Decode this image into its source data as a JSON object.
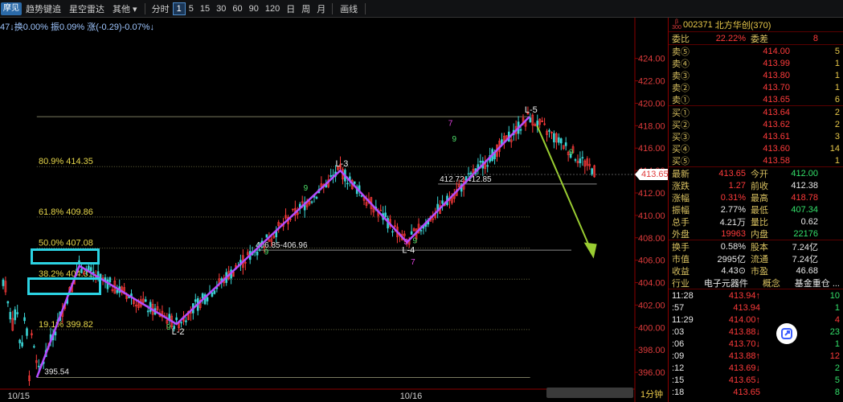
{
  "toolbar": {
    "chip": "摩见",
    "items": [
      "趋势键追",
      "星空雷达",
      "其他 ▾"
    ],
    "period_label": "分时",
    "periods": [
      "1",
      "5",
      "15",
      "30",
      "60",
      "90",
      "120",
      "日",
      "周",
      "月"
    ],
    "active_period": "1",
    "tool_label": "画线"
  },
  "statusline": "47↓换0.00% 振0.09% 涨(-0.29)-0.07%↓",
  "chart_data": {
    "type": "candlestick",
    "ylim": [
      394.5,
      426.2
    ],
    "y_ticks": [
      "424.00",
      "422.00",
      "420.00",
      "418.00",
      "416.00",
      "414.00",
      "412.00",
      "410.00",
      "408.00",
      "406.00",
      "404.00",
      "402.00",
      "400.00",
      "398.00",
      "396.00"
    ],
    "x_labels": [
      "10/15",
      "10/16"
    ],
    "last_price": "413.65",
    "fib_levels": [
      {
        "label": "80.9% 414.35",
        "price": 414.35
      },
      {
        "label": "61.8% 409.86",
        "price": 409.86
      },
      {
        "label": "50.0% 407.08",
        "price": 407.08
      },
      {
        "label": "38.2% 404.31",
        "price": 404.31
      },
      {
        "label": "19.1% 399.82",
        "price": 399.82
      }
    ],
    "range_labels": [
      {
        "label": "406.85-406.96",
        "price": 406.9
      },
      {
        "label": "412.72-412.85",
        "price": 412.8
      }
    ],
    "low_label": "395.54",
    "zigzag": [
      {
        "name": "",
        "t": 0.058,
        "p": 395.54
      },
      {
        "name": "",
        "t": 0.125,
        "p": 405.5
      },
      {
        "name": "L-2",
        "t": 0.278,
        "p": 400.3
      },
      {
        "name": "L-3",
        "t": 0.536,
        "p": 414.0
      },
      {
        "name": "L-4",
        "t": 0.641,
        "p": 407.6
      },
      {
        "name": "L-5",
        "t": 0.834,
        "p": 418.8
      }
    ],
    "projection": {
      "from_t": 0.846,
      "from_p": 418.0,
      "to_t": 0.935,
      "to_p": 406.3
    },
    "wave_counts": [
      {
        "text": "7",
        "t": 0.706,
        "p": 418.0,
        "color": "magenta"
      },
      {
        "text": "9",
        "t": 0.712,
        "p": 416.6,
        "color": "green"
      },
      {
        "text": "9",
        "t": 0.478,
        "p": 412.2,
        "color": "green"
      },
      {
        "text": "7",
        "t": 0.647,
        "p": 405.6,
        "color": "magenta"
      },
      {
        "text": "9",
        "t": 0.65,
        "p": 407.5,
        "color": "green"
      },
      {
        "text": "3",
        "t": 0.636,
        "p": 407.4,
        "color": "magenta"
      },
      {
        "text": "9",
        "t": 0.896,
        "p": 415.4,
        "color": "green"
      },
      {
        "text": "9",
        "t": 0.262,
        "p": 399.8,
        "color": "green"
      },
      {
        "text": "9",
        "t": 0.416,
        "p": 406.5,
        "color": "green"
      }
    ]
  },
  "panel": {
    "mark": "β 300",
    "code": "002371",
    "name": "北方华创(370)",
    "weibi": {
      "label": "委比",
      "value": "22.22%",
      "label2": "委差",
      "value2": "8"
    },
    "asks": [
      {
        "label": "卖⑤",
        "price": "414.00",
        "vol": "5"
      },
      {
        "label": "卖④",
        "price": "413.99",
        "vol": "1"
      },
      {
        "label": "卖③",
        "price": "413.80",
        "vol": "1"
      },
      {
        "label": "卖②",
        "price": "413.70",
        "vol": "1"
      },
      {
        "label": "卖①",
        "price": "413.65",
        "vol": "6"
      }
    ],
    "bids": [
      {
        "label": "买①",
        "price": "413.64",
        "vol": "2"
      },
      {
        "label": "买②",
        "price": "413.62",
        "vol": "2"
      },
      {
        "label": "买③",
        "price": "413.61",
        "vol": "3"
      },
      {
        "label": "买④",
        "price": "413.60",
        "vol": "14"
      },
      {
        "label": "买⑤",
        "price": "413.58",
        "vol": "1"
      }
    ],
    "quote": [
      {
        "l1": "最新",
        "v1": "413.65",
        "l2": "今开",
        "v2": "412.00",
        "c1": "red",
        "c2": "green"
      },
      {
        "l1": "涨跌",
        "v1": "1.27",
        "l2": "前收",
        "v2": "412.38",
        "c1": "red",
        "c2": "white"
      },
      {
        "l1": "涨幅",
        "v1": "0.31%",
        "l2": "最高",
        "v2": "418.78",
        "c1": "red",
        "c2": "red"
      },
      {
        "l1": "振幅",
        "v1": "2.77%",
        "l2": "最低",
        "v2": "407.34",
        "c1": "white",
        "c2": "green"
      },
      {
        "l1": "总手",
        "v1": "4.21万",
        "l2": "量比",
        "v2": "0.62",
        "c1": "white",
        "c2": "white"
      },
      {
        "l1": "外盘",
        "v1": "19963",
        "l2": "内盘",
        "v2": "22176",
        "c1": "red",
        "c2": "green"
      }
    ],
    "stats": [
      {
        "l1": "换手",
        "v1": "0.58%",
        "l2": "股本",
        "v2": "7.24亿"
      },
      {
        "l1": "市值",
        "v1": "2995亿",
        "l2": "流通",
        "v2": "7.24亿"
      },
      {
        "l1": "收益",
        "v1": "4.43⊙",
        "l2": "市盈",
        "v2": "46.68"
      }
    ],
    "industry": {
      "label": "行业",
      "value": "电子元器件",
      "label2": "概念",
      "value2": "基金重仓 ..."
    },
    "ticks": [
      {
        "time": "11:28",
        "price": "413.94↑",
        "vol": "10",
        "pc": "red",
        "vc": "green"
      },
      {
        "time": ":57",
        "price": "413.94",
        "vol": "1",
        "pc": "red",
        "vc": "green"
      },
      {
        "time": "11:29",
        "price": "414.00↑",
        "vol": "4",
        "pc": "red",
        "vc": "red"
      },
      {
        "time": ":03",
        "price": "413.88↓",
        "vol": "23",
        "pc": "red",
        "vc": "green"
      },
      {
        "time": ":06",
        "price": "413.70↓",
        "vol": "1",
        "pc": "red",
        "vc": "green"
      },
      {
        "time": ":09",
        "price": "413.88↑",
        "vol": "12",
        "pc": "red",
        "vc": "red"
      },
      {
        "time": ":12",
        "price": "413.69↓",
        "vol": "2",
        "pc": "red",
        "vc": "green"
      },
      {
        "time": ":15",
        "price": "413.65↓",
        "vol": "5",
        "pc": "red",
        "vc": "green"
      },
      {
        "time": ":18",
        "price": "413.65",
        "vol": "8",
        "pc": "red",
        "vc": "green"
      }
    ],
    "unit_label": "1分钟"
  }
}
